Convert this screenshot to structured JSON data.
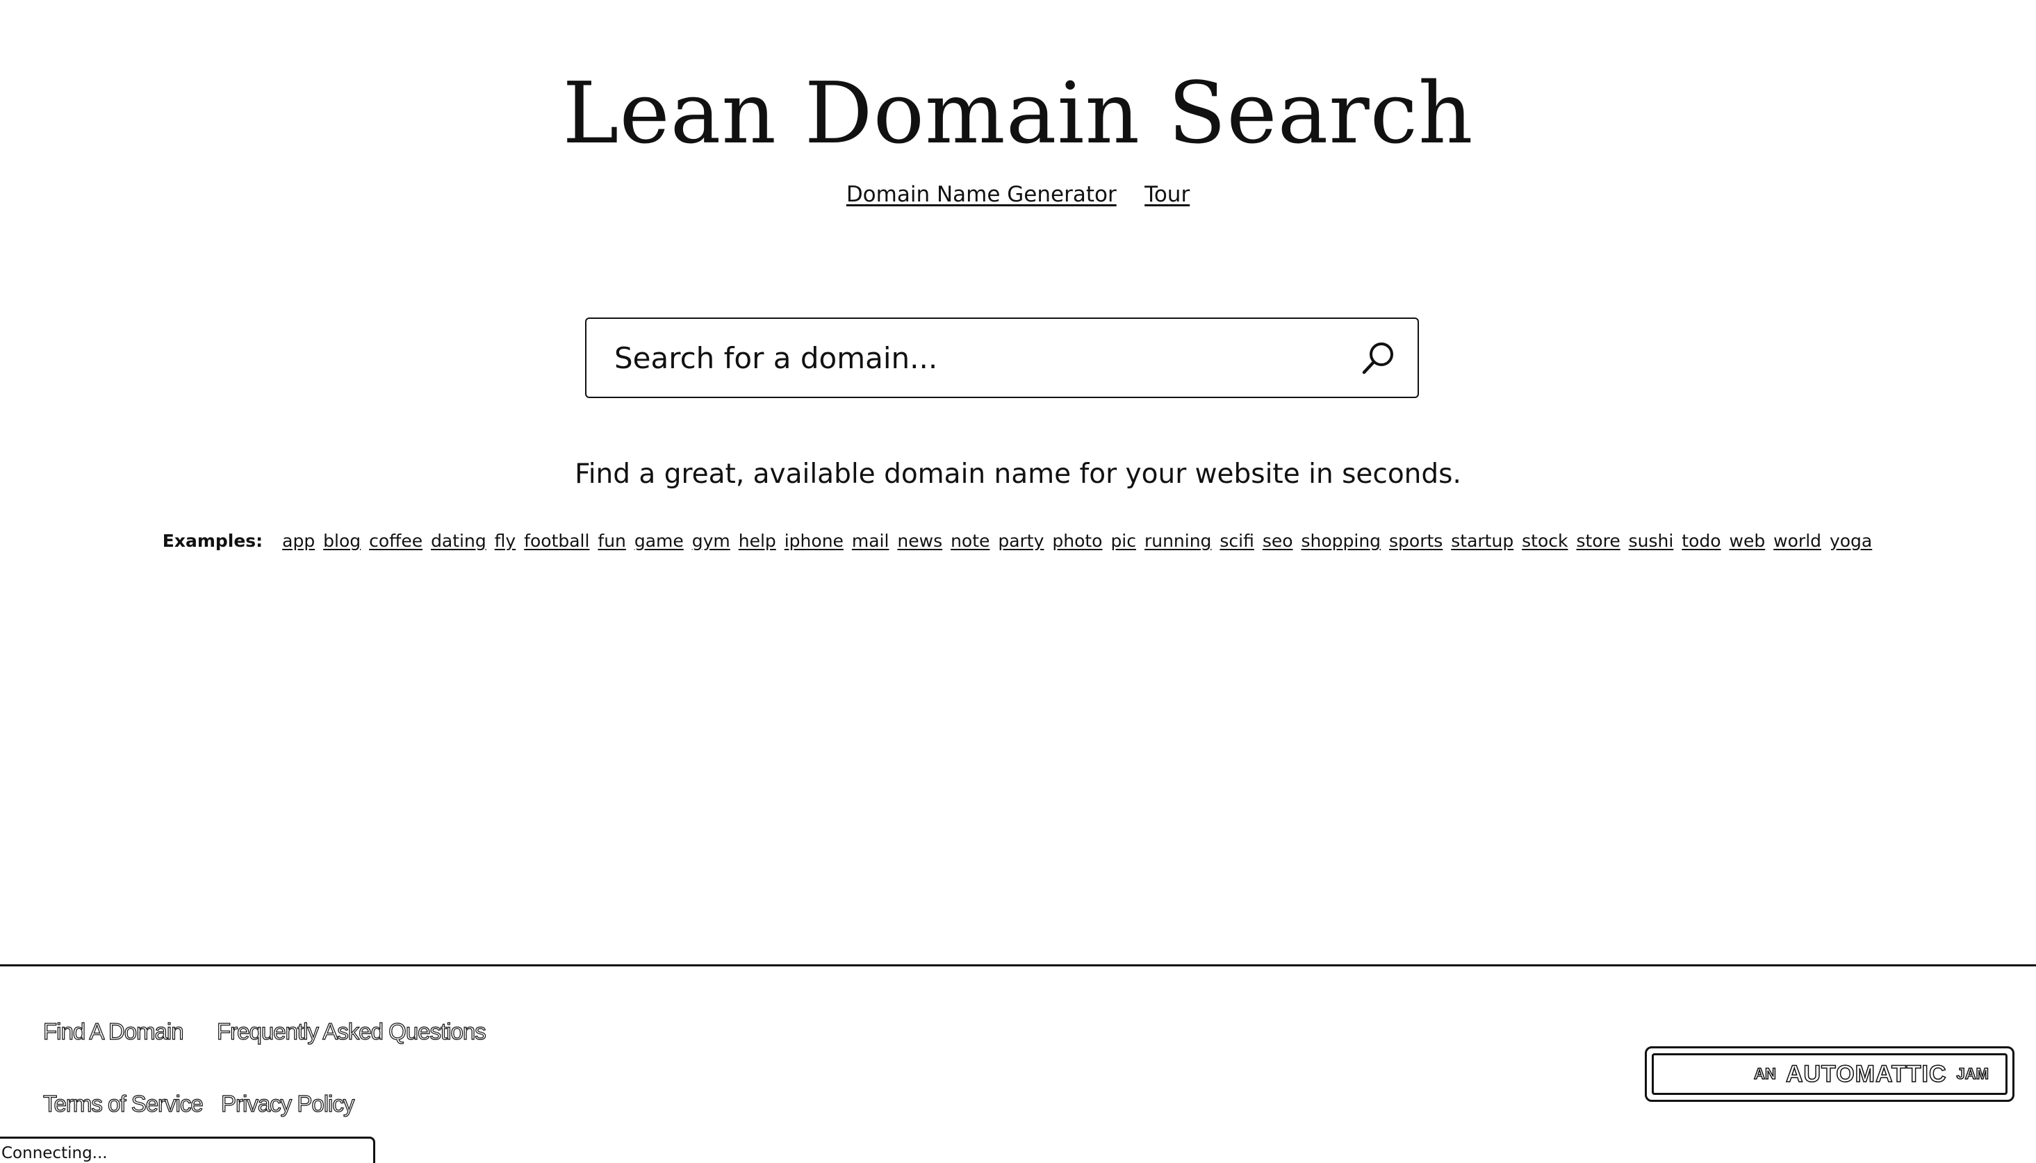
{
  "header": {
    "title": "Lean Domain Search",
    "nav": [
      {
        "label": "Domain Name Generator"
      },
      {
        "label": "Tour"
      }
    ]
  },
  "search": {
    "placeholder": "Search for a domain...",
    "value": "",
    "button_icon": "search-icon"
  },
  "tagline": "Find a great, available domain name for your website in seconds.",
  "examples": {
    "label": "Examples:",
    "items": [
      "app",
      "blog",
      "coffee",
      "dating",
      "fly",
      "football",
      "fun",
      "game",
      "gym",
      "help",
      "iphone",
      "mail",
      "news",
      "note",
      "party",
      "photo",
      "pic",
      "running",
      "scifi",
      "seo",
      "shopping",
      "sports",
      "startup",
      "stock",
      "store",
      "sushi",
      "todo",
      "web",
      "world",
      "yoga"
    ]
  },
  "footer": {
    "links": [
      {
        "label": "Find A Domain"
      },
      {
        "label": "Frequently Asked Questions"
      },
      {
        "label": "Terms of Service"
      },
      {
        "label": "Privacy Policy"
      }
    ],
    "badge": {
      "prefix": "AN",
      "brand": "AUTOMATTIC",
      "suffix": "JAM"
    }
  },
  "status": {
    "text": "Connecting..."
  },
  "colors": {
    "text": "#111111",
    "background": "#ffffff"
  }
}
